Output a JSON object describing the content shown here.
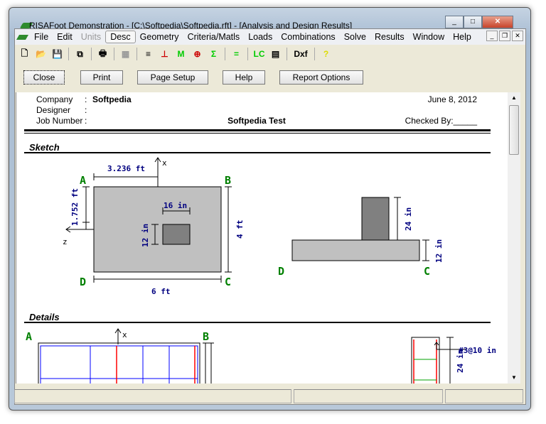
{
  "window": {
    "title": "RISAFoot Demonstration - [C:\\Softpedia\\Softpedia.rft] - [Analysis and Design Results]",
    "minimize": "_",
    "maximize": "□",
    "close": "✕"
  },
  "menu": [
    "File",
    "Edit",
    "Units",
    "Desc",
    "Geometry",
    "Criteria/Matls",
    "Loads",
    "Combinations",
    "Solve",
    "Results",
    "Window",
    "Help"
  ],
  "mdi_controls": [
    "_",
    "❐",
    "✕"
  ],
  "toolbar": [
    {
      "icon": "new-file-icon",
      "glyph": "🗋"
    },
    {
      "icon": "open-folder-icon",
      "glyph": "📂"
    },
    {
      "icon": "save-icon",
      "glyph": "💾"
    },
    {
      "icon": "copy-icon",
      "glyph": "⧉"
    },
    {
      "icon": "print-icon",
      "glyph": "🖶"
    },
    {
      "icon": "units-icon",
      "glyph": "▦"
    },
    {
      "icon": "text-lines-icon",
      "glyph": "≡"
    },
    {
      "icon": "geometry-icon",
      "glyph": "⊥"
    },
    {
      "icon": "moment-icon",
      "glyph": "M"
    },
    {
      "icon": "load-icon",
      "glyph": "⊕"
    },
    {
      "icon": "sum-icon",
      "glyph": "Σ"
    },
    {
      "icon": "equals-icon",
      "glyph": "="
    },
    {
      "icon": "load-combination-icon",
      "glyph": "LC"
    },
    {
      "icon": "report-icon",
      "glyph": "▤"
    },
    {
      "icon": "dxf-icon",
      "glyph": "Dxf"
    },
    {
      "icon": "help-icon",
      "glyph": "?"
    }
  ],
  "buttons": {
    "close": "Close",
    "print": "Print",
    "page_setup": "Page Setup",
    "help": "Help",
    "report_options": "Report Options"
  },
  "report": {
    "company_label": "Company",
    "company": "Softpedia",
    "designer_label": "Designer",
    "job_label": "Job Number",
    "sep": ":",
    "date": "June 8, 2012",
    "title": "Softpedia Test",
    "checked_by": "Checked By:_____",
    "sketch_heading": "Sketch",
    "details_heading": "Details",
    "plan": {
      "A": "A",
      "B": "B",
      "C": "C",
      "D": "D",
      "dim_x": "3.236 ft",
      "dim_z": "1.752 ft",
      "pedestal_w": "16 in",
      "pedestal_l": "12 in",
      "length": "4 ft",
      "width": "6 ft",
      "x_axis": "x",
      "z_axis": "z"
    },
    "elevation": {
      "D": "D",
      "C": "C",
      "pedestal_h": "24 in",
      "footing_t": "12 in"
    },
    "details": {
      "A": "A",
      "B": "B",
      "x_axis": "x",
      "rebar": "#3@10 in",
      "height": "24 in"
    }
  },
  "colors": {
    "point_label": "#008000",
    "dimension": "#000080",
    "rebar_red": "#ff0000",
    "rebar_blue": "#0000ff",
    "rebar_green": "#00a000"
  }
}
